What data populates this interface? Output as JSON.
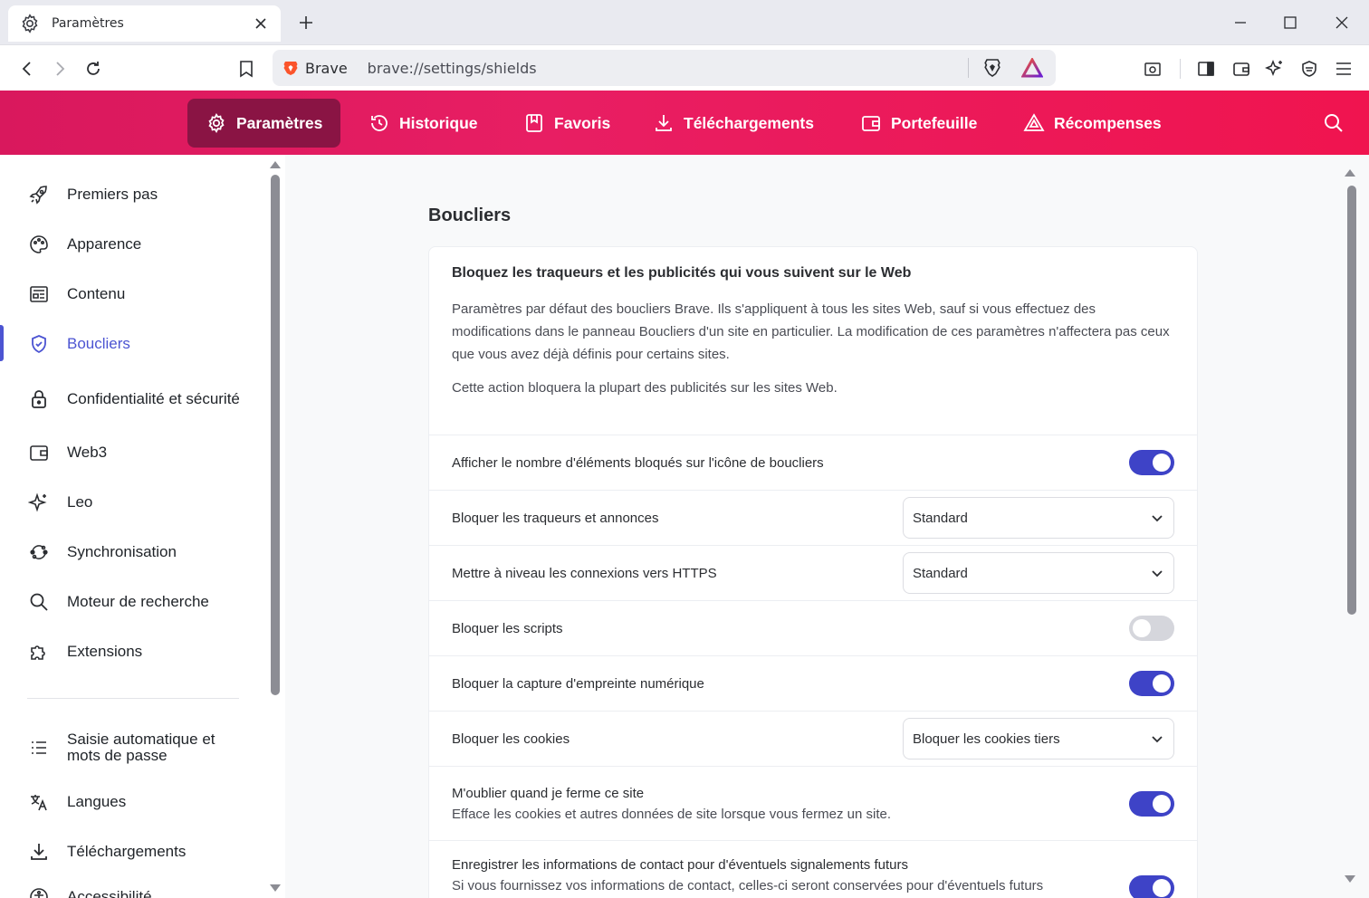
{
  "tab": {
    "title": "Paramètres"
  },
  "toolbar": {
    "site_name": "Brave",
    "url": "brave://settings/shields"
  },
  "header": {
    "nav": [
      {
        "label": "Paramètres",
        "icon": "gear-icon",
        "active": true
      },
      {
        "label": "Historique",
        "icon": "history-icon"
      },
      {
        "label": "Favoris",
        "icon": "bookmark-icon"
      },
      {
        "label": "Téléchargements",
        "icon": "download-icon"
      },
      {
        "label": "Portefeuille",
        "icon": "wallet-icon"
      },
      {
        "label": "Récompenses",
        "icon": "rewards-icon"
      }
    ]
  },
  "sidebar": {
    "items": [
      {
        "label": "Premiers pas",
        "icon": "rocket-icon"
      },
      {
        "label": "Apparence",
        "icon": "palette-icon"
      },
      {
        "label": "Contenu",
        "icon": "content-icon"
      },
      {
        "label": "Boucliers",
        "icon": "shield-icon",
        "active": true
      },
      {
        "label": "Confidentialité et sécurité",
        "icon": "lock-icon"
      },
      {
        "label": "Web3",
        "icon": "wallet-icon"
      },
      {
        "label": "Leo",
        "icon": "sparkle-icon"
      },
      {
        "label": "Synchronisation",
        "icon": "sync-icon"
      },
      {
        "label": "Moteur de recherche",
        "icon": "search-icon"
      },
      {
        "label": "Extensions",
        "icon": "puzzle-icon"
      },
      {
        "label": "Saisie automatique et mots de passe",
        "icon": "list-icon"
      },
      {
        "label": "Langues",
        "icon": "translate-icon"
      },
      {
        "label": "Téléchargements",
        "icon": "download-icon"
      },
      {
        "label": "Accessibilité",
        "icon": "accessibility-icon"
      }
    ]
  },
  "main": {
    "section_title": "Boucliers",
    "card_title": "Bloquez les traqueurs et les publicités qui vous suivent sur le Web",
    "card_desc": "Paramètres par défaut des boucliers Brave. Ils s'appliquent à tous les sites Web, sauf si vous effectuez des modifications dans le panneau Boucliers d'un site en particulier. La modification de ces paramètres n'affectera pas ceux que vous avez déjà définis pour certains sites.",
    "card_note": "Cette action bloquera la plupart des publicités sur les sites Web.",
    "rows": [
      {
        "label": "Afficher le nombre d'éléments bloqués sur l'icône de boucliers",
        "control": "toggle",
        "on": true
      },
      {
        "label": "Bloquer les traqueurs et annonces",
        "control": "select",
        "value": "Standard"
      },
      {
        "label": "Mettre à niveau les connexions vers HTTPS",
        "control": "select",
        "value": "Standard"
      },
      {
        "label": "Bloquer les scripts",
        "control": "toggle",
        "on": false
      },
      {
        "label": "Bloquer la capture d'empreinte numérique",
        "control": "toggle",
        "on": true
      },
      {
        "label": "Bloquer les cookies",
        "control": "select",
        "value": "Bloquer les cookies tiers"
      },
      {
        "label": "M'oublier quand je ferme ce site",
        "sub": "Efface les cookies et autres données de site lorsque vous fermez un site.",
        "control": "toggle",
        "on": true
      },
      {
        "label": "Enregistrer les informations de contact pour d'éventuels signalements futurs",
        "sub": "Si vous fournissez vos informations de contact, celles-ci seront conservées pour d'éventuels futurs",
        "control": "toggle",
        "on": true
      }
    ]
  },
  "colors": {
    "accent": "#4c54d2",
    "header_start": "#d9185d",
    "header_end": "#f0144f",
    "toggle_on": "#3e43c7"
  }
}
